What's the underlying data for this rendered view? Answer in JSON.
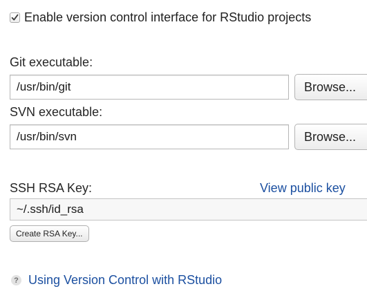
{
  "version_control": {
    "enable_checkbox": {
      "label": "Enable version control interface for RStudio projects",
      "checked": true
    }
  },
  "git": {
    "label": "Git executable:",
    "path": "/usr/bin/git",
    "browse_label": "Browse..."
  },
  "svn": {
    "label": "SVN executable:",
    "path": "/usr/bin/svn",
    "browse_label": "Browse..."
  },
  "ssh": {
    "label": "SSH RSA Key:",
    "view_link": "View public key",
    "key_path": "~/.ssh/id_rsa",
    "create_button": "Create RSA Key..."
  },
  "help": {
    "icon": "question-icon",
    "link": "Using Version Control with RStudio"
  },
  "colors": {
    "link": "#1b4fa0",
    "help_icon_bg": "#e2e2e2"
  }
}
